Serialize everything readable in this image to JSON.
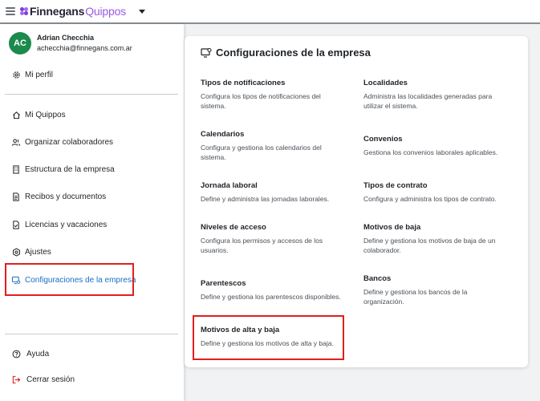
{
  "brand": {
    "part1": "Finnegans",
    "part2": "Quippos"
  },
  "user": {
    "initials": "AC",
    "name": "Adrian Checchia",
    "email": "achecchia@finnegans.com.ar"
  },
  "sidebar": {
    "profile": "Mi perfil",
    "items": [
      {
        "label": "Mi Quippos",
        "icon": "home-icon"
      },
      {
        "label": "Organizar colaboradores",
        "icon": "users-icon"
      },
      {
        "label": "Estructura de la empresa",
        "icon": "building-icon"
      },
      {
        "label": "Recibos y documentos",
        "icon": "document-icon"
      },
      {
        "label": "Licencias y vacaciones",
        "icon": "leave-icon"
      },
      {
        "label": "Ajustes",
        "icon": "settings-icon"
      },
      {
        "label": "Configuraciones de la empresa",
        "icon": "monitor-gear-icon",
        "active": true
      }
    ],
    "help": "Ayuda",
    "logout": "Cerrar sesión"
  },
  "content": {
    "title": "Configuraciones de la empresa",
    "left": [
      {
        "title": "Tipos de notificaciones",
        "desc": "Configura los tipos de notificaciones del sistema."
      },
      {
        "title": "Calendarios",
        "desc": "Configura y gestiona los calendarios del sistema."
      },
      {
        "title": "Jornada laboral",
        "desc": "Define y administra las jornadas laborales."
      },
      {
        "title": "Niveles de acceso",
        "desc": "Configura los permisos y accesos de los usuarios."
      },
      {
        "title": "Parentescos",
        "desc": "Define y gestiona los parentescos disponibles."
      },
      {
        "title": "Motivos de alta y baja",
        "desc": "Define y gestiona los motivos de alta y baja."
      }
    ],
    "right": [
      {
        "title": "Localidades",
        "desc": "Administra las localidades generadas para utilizar el sistema."
      },
      {
        "title": "Convenios",
        "desc": "Gestiona los convenios laborales aplicables."
      },
      {
        "title": "Tipos de contrato",
        "desc": "Configura y administra los tipos de contrato."
      },
      {
        "title": "Motivos de baja",
        "desc": "Define y gestiona los motivos de baja de un colaborador."
      },
      {
        "title": "Bancos",
        "desc": "Define y gestiona los bancos de la organización."
      }
    ]
  },
  "colors": {
    "accent": "#1a6fc4",
    "brand": "#7b3fd6",
    "highlight": "#e01f1f",
    "avatar": "#1b8a4c"
  }
}
